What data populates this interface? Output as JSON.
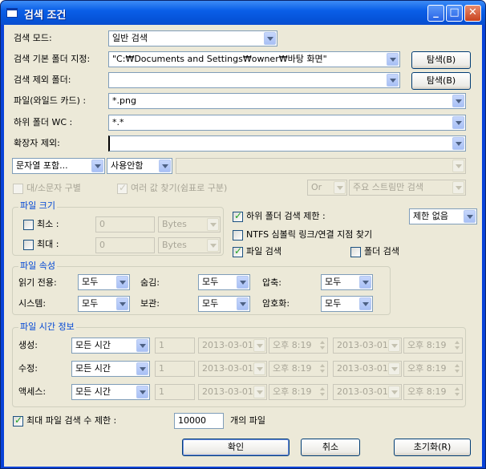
{
  "window": {
    "title": "검색 조건",
    "min": "_",
    "max": "□",
    "close": "✕"
  },
  "row_mode": {
    "label": "검색 모드:",
    "value": "일반 검색"
  },
  "row_base": {
    "label": "검색 기본 폴더 지정:",
    "value": "\"C:₩Documents and Settings₩owner₩바탕 화면\"",
    "button": "탐색(B)"
  },
  "row_exclude": {
    "label": "검색 제외 폴더:",
    "value": "",
    "button": "탐색(B)"
  },
  "row_file": {
    "label": "파일(와일드 카드) :",
    "value": "*.png"
  },
  "row_sub": {
    "label": "하위 폴더 WC :",
    "value": "*.*"
  },
  "row_ext": {
    "label": "확장자 제외:",
    "value": ""
  },
  "text_row": {
    "mode": "문자열 포함...",
    "charset": "사용안함",
    "text": ""
  },
  "opts": {
    "case": "대/소문자 구별",
    "multi": "여러 값 찾기(쉼표로 구분)",
    "op": "Or",
    "stream": "주요 스트림만 검색"
  },
  "size": {
    "title": "파일 크기",
    "min_label": "최소 :",
    "min_value": "0",
    "min_unit": "Bytes",
    "max_label": "최대 :",
    "max_value": "0",
    "max_unit": "Bytes"
  },
  "right_opts": {
    "sublimit": "하위 폴더 검색 제한 :",
    "sublimit_value": "제한 없음",
    "ntfs": "NTFS 심볼릭 링크/연결 지점 찾기",
    "filesearch": "파일 검색",
    "foldersearch": "폴더 검색"
  },
  "attr": {
    "title": "파일 속성",
    "readonly_label": "읽기 전용:",
    "readonly_value": "모두",
    "hidden_label": "숨김:",
    "hidden_value": "모두",
    "compressed_label": "압축:",
    "compressed_value": "모두",
    "system_label": "시스템:",
    "system_value": "모두",
    "archive_label": "보관:",
    "archive_value": "모두",
    "encrypted_label": "암호화:",
    "encrypted_value": "모두"
  },
  "time": {
    "title": "파일 시간 정보",
    "rows": [
      {
        "label": "생성:",
        "mode": "모든 시간",
        "num": "1",
        "date1": "2013-03-01",
        "time1": "오후 8:19",
        "date2": "2013-03-01",
        "time2": "오후 8:19"
      },
      {
        "label": "수정:",
        "mode": "모든 시간",
        "num": "1",
        "date1": "2013-03-01",
        "time1": "오후 8:19",
        "date2": "2013-03-01",
        "time2": "오후 8:19"
      },
      {
        "label": "액세스:",
        "mode": "모든 시간",
        "num": "1",
        "date1": "2013-03-01",
        "time1": "오후 8:19",
        "date2": "2013-03-01",
        "time2": "오후 8:19"
      }
    ]
  },
  "maxfiles": {
    "label": "최대 파일 검색 수 제한 :",
    "value": "10000",
    "unit": "개의 파일"
  },
  "buttons": {
    "ok": "확인",
    "cancel": "취소",
    "reset": "초기화(R)"
  }
}
